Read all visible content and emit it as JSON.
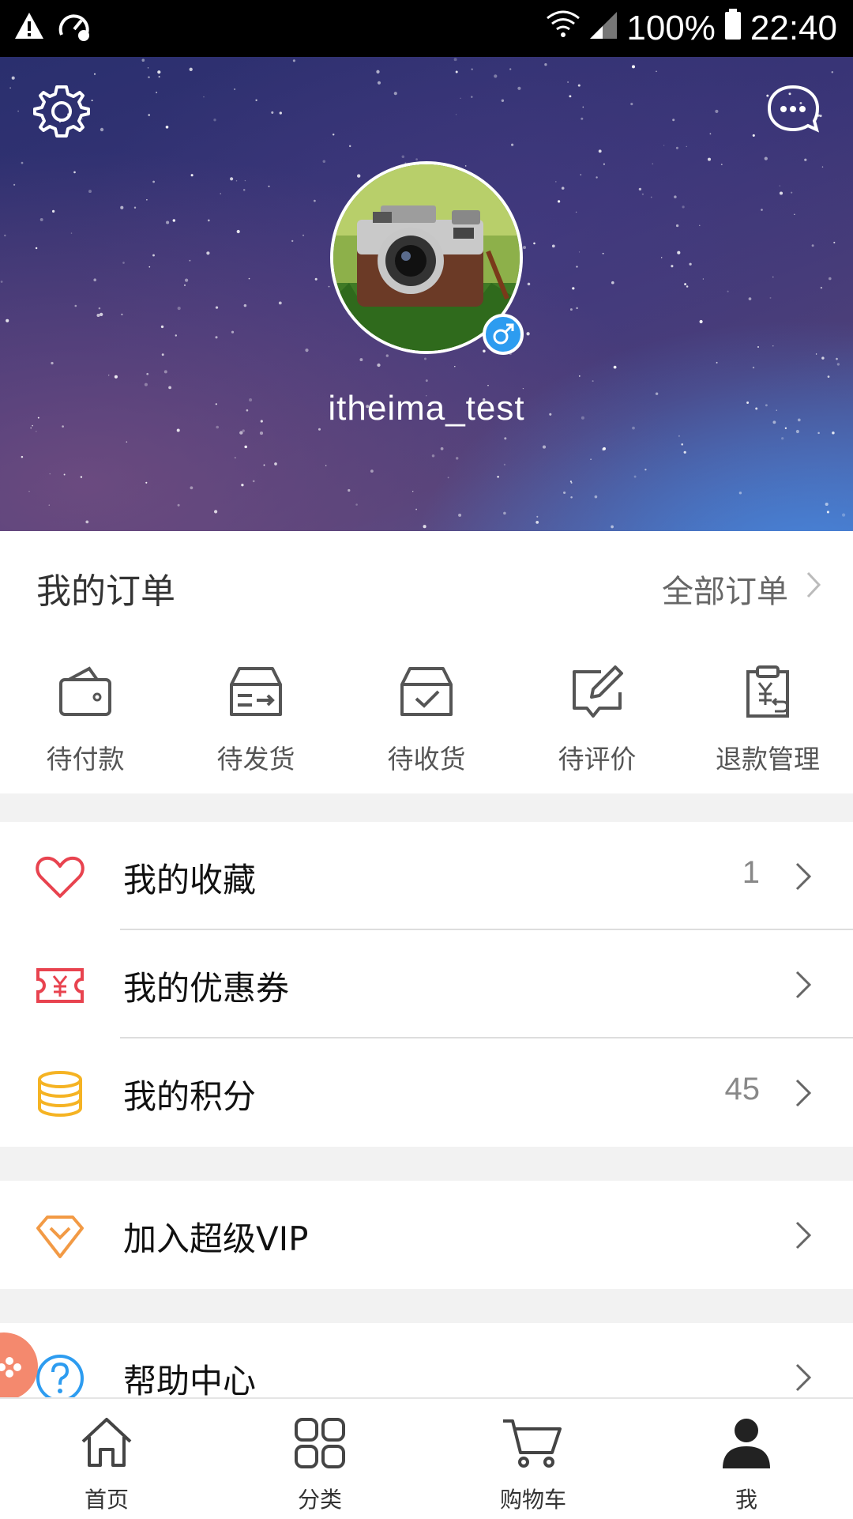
{
  "status_bar": {
    "left_icons": [
      "warning-icon",
      "speedometer-icon"
    ],
    "battery": "100%",
    "time": "22:40",
    "right_icons": [
      "wifi-icon",
      "signal-icon",
      "battery-icon"
    ]
  },
  "header": {
    "settings_icon": "gear-icon",
    "message_icon": "chat-bubble-icon",
    "avatar": "camera-photo",
    "gender": "male",
    "username": "itheima_test"
  },
  "orders": {
    "title": "我的订单",
    "all_label": "全部订单",
    "items": [
      {
        "label": "待付款",
        "icon": "wallet-icon"
      },
      {
        "label": "待发货",
        "icon": "ship-box-icon"
      },
      {
        "label": "待收货",
        "icon": "receive-box-icon"
      },
      {
        "label": "待评价",
        "icon": "edit-icon"
      },
      {
        "label": "退款管理",
        "icon": "refund-icon"
      }
    ]
  },
  "menu": {
    "favorites": {
      "label": "我的收藏",
      "value": "1",
      "icon": "heart-icon",
      "color": "#e8434f"
    },
    "coupons": {
      "label": "我的优惠券",
      "value": "",
      "icon": "coupon-icon",
      "color": "#e8434f"
    },
    "points": {
      "label": "我的积分",
      "value": "45",
      "icon": "coins-icon",
      "color": "#f5b323"
    },
    "vip": {
      "label": "加入超级VIP",
      "icon": "diamond-icon",
      "color": "#f29a45"
    },
    "help": {
      "label": "帮助中心",
      "icon": "question-icon",
      "color": "#2d9cf0"
    }
  },
  "tabbar": {
    "tabs": [
      {
        "label": "首页",
        "icon": "home-icon"
      },
      {
        "label": "分类",
        "icon": "grid-icon"
      },
      {
        "label": "购物车",
        "icon": "cart-icon"
      },
      {
        "label": "我",
        "icon": "person-icon",
        "active": true
      }
    ]
  },
  "colors": {
    "accent_blue": "#2d9cf0",
    "text_dark": "#222222",
    "text_grey": "#888888"
  }
}
